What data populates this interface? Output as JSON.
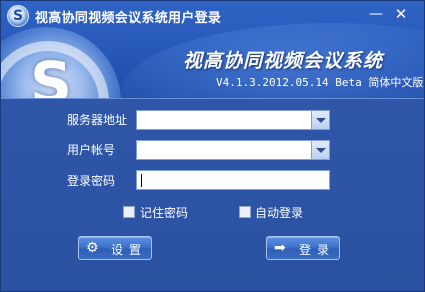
{
  "window": {
    "title": "视高协同视频会议系统用户登录",
    "minimize_glyph": "—",
    "close_glyph": "✕"
  },
  "banner": {
    "logo_letter": "S",
    "product_name": "视高协同视频会议系统",
    "version": "V4.1.3.2012.05.14 Beta 简体中文版"
  },
  "form": {
    "server_label": "服务器地址",
    "server_value": "",
    "account_label": "用户帐号",
    "account_value": "",
    "password_label": "登录密码",
    "password_value": ""
  },
  "options": {
    "remember_label": "记住密码",
    "remember_checked": false,
    "autologin_label": "自动登录",
    "autologin_checked": false
  },
  "buttons": {
    "settings_label": "设置",
    "settings_icon": "gear-icon",
    "login_label": "登录",
    "login_icon": "arrow-right-icon"
  },
  "colors": {
    "background": "#2d53a4",
    "button_top": "#5d8fe2",
    "button_bottom": "#2f5fb8"
  }
}
